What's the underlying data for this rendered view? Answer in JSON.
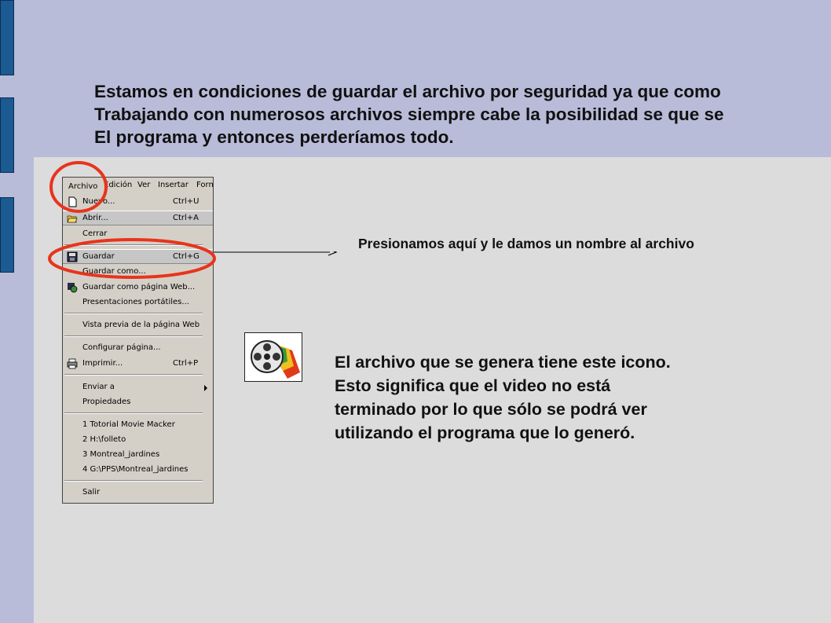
{
  "heading": {
    "line1": "Estamos en condiciones de guardar el archivo por seguridad ya que como",
    "line2": "Trabajando con numerosos archivos siempre cabe la posibilidad se que se",
    "line3": "El programa y entonces perderíamos todo."
  },
  "menubar": {
    "archivo": "Archivo",
    "edicion": "Edición",
    "ver": "Ver",
    "insertar": "Insertar",
    "formato": "Form"
  },
  "menu": {
    "nuevo": {
      "label": "Nuevo...",
      "shortcut": "Ctrl+U"
    },
    "abrir": {
      "label": "Abrir...",
      "shortcut": "Ctrl+A"
    },
    "cerrar": {
      "label": "Cerrar"
    },
    "guardar": {
      "label": "Guardar",
      "shortcut": "Ctrl+G"
    },
    "guardar_como": {
      "label": "Guardar como..."
    },
    "guardar_web": {
      "label": "Guardar como página Web..."
    },
    "presentaciones": {
      "label": "Presentaciones portátiles..."
    },
    "vista_previa": {
      "label": "Vista previa de la página Web"
    },
    "configurar": {
      "label": "Configurar página..."
    },
    "imprimir": {
      "label": "Imprimir...",
      "shortcut": "Ctrl+P"
    },
    "enviar": {
      "label": "Enviar a"
    },
    "propiedades": {
      "label": "Propiedades"
    },
    "recent1": {
      "label": "1 Totorial Movie Macker"
    },
    "recent2": {
      "label": "2 H:\\folleto"
    },
    "recent3": {
      "label": "3 Montreal_jardines"
    },
    "recent4": {
      "label": "4 G:\\PPS\\Montreal_jardines"
    },
    "salir": {
      "label": "Salir"
    }
  },
  "annotation": {
    "arrow_text": "Presionamos aquí y le damos un nombre al archivo"
  },
  "description": {
    "line1": "El archivo que se genera tiene este icono.",
    "line2": "Esto significa que el video no está",
    "line3": "terminado por lo que sólo se podrá ver",
    "line4": "utilizando el programa que lo generó."
  },
  "colors": {
    "background": "#b8bcd9",
    "panel": "#dcdcdc",
    "accent_tab": "#1c5a92",
    "highlight_ellipse": "#e8341c"
  },
  "icons": {
    "file_icon": "movie-maker-project-icon"
  }
}
